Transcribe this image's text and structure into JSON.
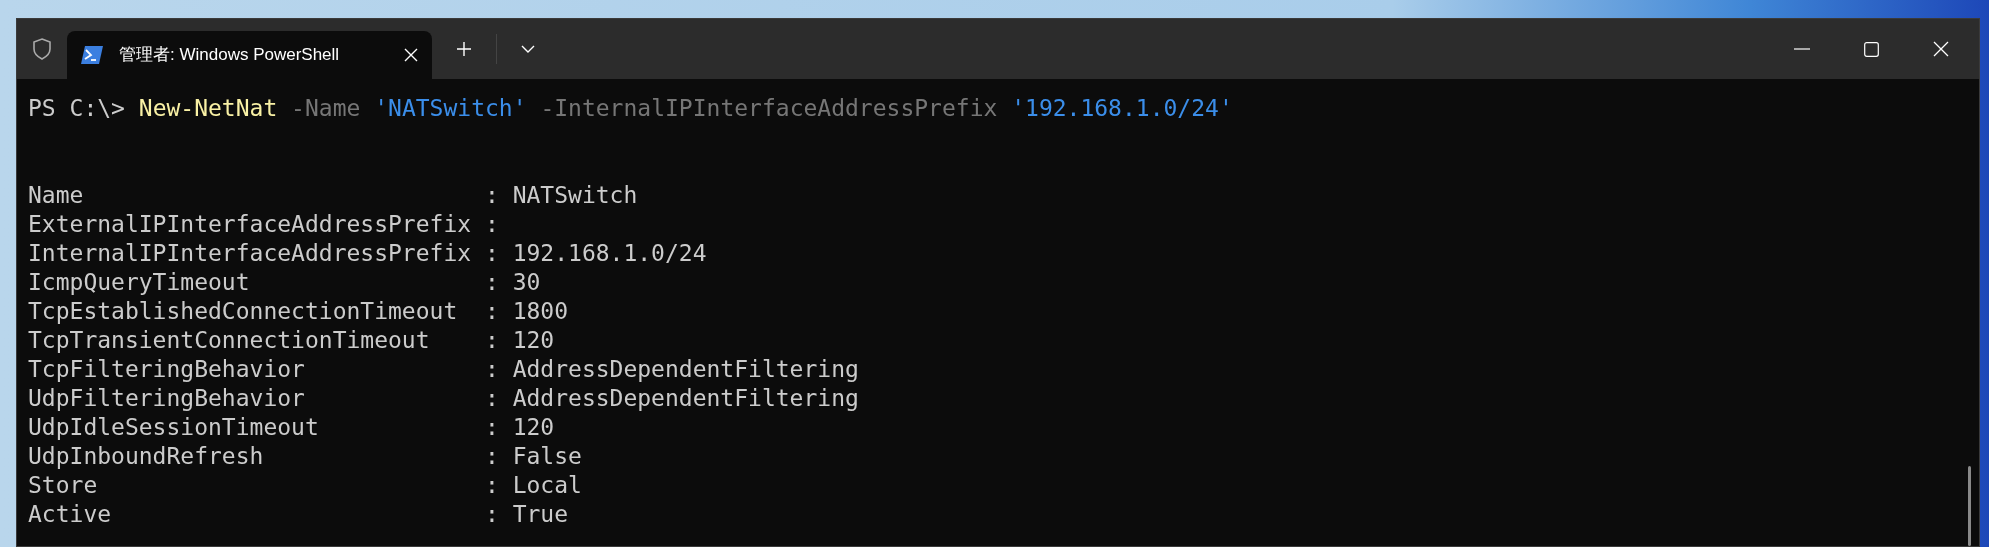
{
  "window": {
    "tab": {
      "title": "管理者: Windows PowerShell",
      "selected": true
    }
  },
  "terminal": {
    "command": [
      {
        "kind": "prompt",
        "text": "PS C:\\> "
      },
      {
        "kind": "command",
        "text": "New-NetNat"
      },
      {
        "kind": "parameter",
        "text": " -Name "
      },
      {
        "kind": "string",
        "text": "'NATSwitch'"
      },
      {
        "kind": "parameter",
        "text": " -InternalIPInterfaceAddressPrefix "
      },
      {
        "kind": "string",
        "text": "'192.168.1.0/24'"
      }
    ],
    "output": [
      "Name                             : NATSwitch",
      "ExternalIPInterfaceAddressPrefix :",
      "InternalIPInterfaceAddressPrefix : 192.168.1.0/24",
      "IcmpQueryTimeout                 : 30",
      "TcpEstablishedConnectionTimeout  : 1800",
      "TcpTransientConnectionTimeout    : 120",
      "TcpFilteringBehavior             : AddressDependentFiltering",
      "UdpFilteringBehavior             : AddressDependentFiltering",
      "UdpIdleSessionTimeout            : 120",
      "UdpInboundRefresh                : False",
      "Store                            : Local",
      "Active                           : True"
    ]
  }
}
